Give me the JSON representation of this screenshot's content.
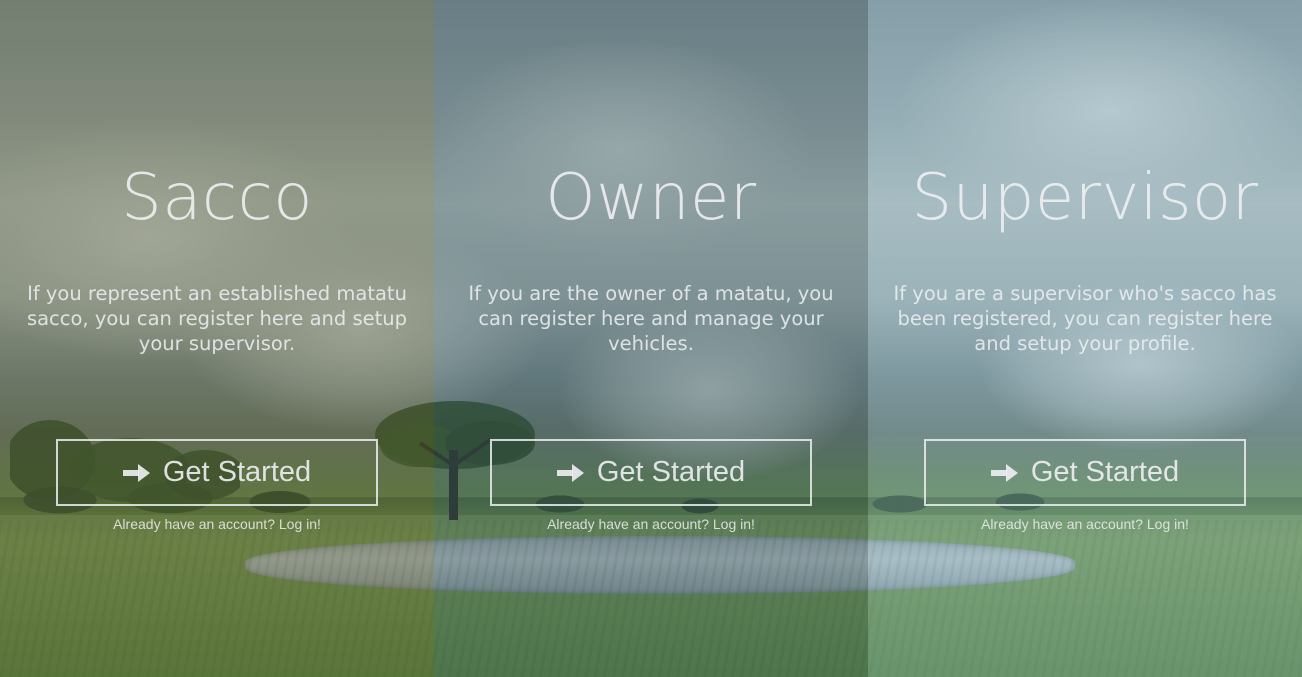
{
  "panels": [
    {
      "key": "sacco",
      "title": "Sacco",
      "description": "If you represent an established matatu sacco, you can register here and setup your supervisor.",
      "button_label": "Get Started",
      "button_icon": "arrow-right-icon",
      "login_text": "Already have an account? Log in!"
    },
    {
      "key": "owner",
      "title": "Owner",
      "description": "If you are the owner of a matatu, you can register here and manage your vehicles.",
      "button_label": "Get Started",
      "button_icon": "arrow-right-icon",
      "login_text": "Already have an account? Log in!"
    },
    {
      "key": "supervisor",
      "title": "Supervisor",
      "description": "If you are a supervisor who's sacco has been registered, you can register here and setup your profile.",
      "button_label": "Get Started",
      "button_icon": "arrow-right-icon",
      "login_text": "Already have an account? Log in!"
    }
  ],
  "colors": {
    "sacco_overlay": "#555c3c",
    "owner_overlay": "#375864",
    "supervisor_overlay": "#78a5be",
    "text": "#eef0f2"
  }
}
